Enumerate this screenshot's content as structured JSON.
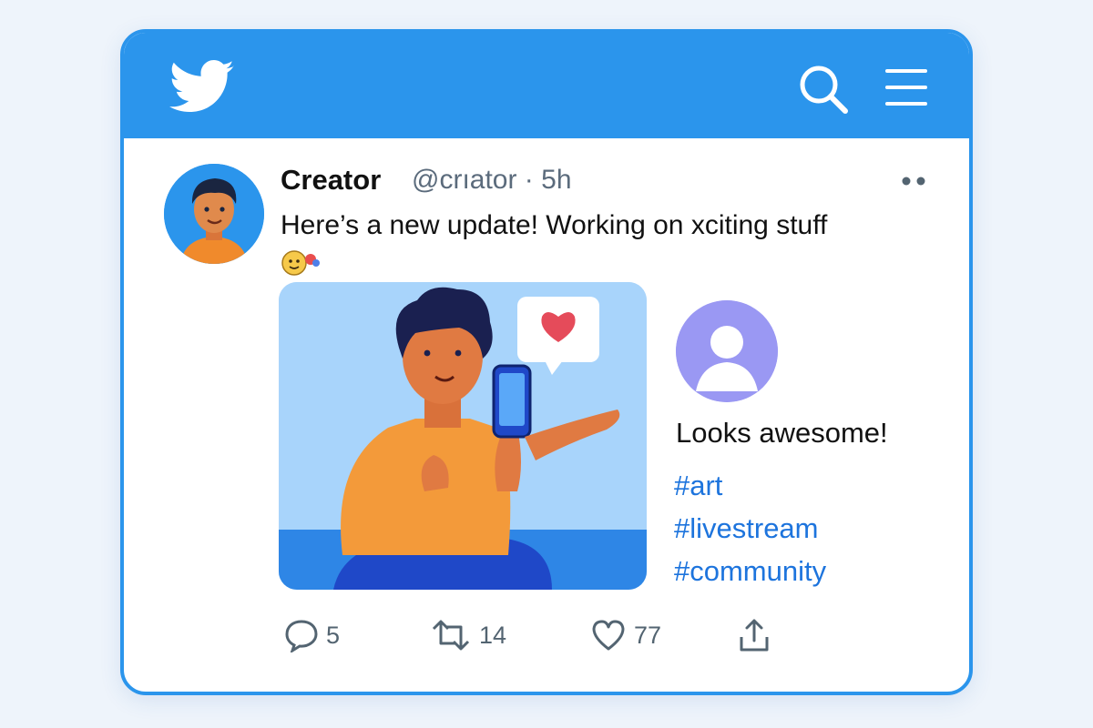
{
  "header": {
    "logo_icon": "bird-icon",
    "search_icon": "search-icon",
    "menu_icon": "hamburger-menu-icon",
    "color": "#2b95ec"
  },
  "tweet": {
    "author_name": "Creator",
    "author_handle": "@crıator · 5h",
    "text": "Here’s a new update! Working on xciting stuff",
    "more_icon": "more-options-icon",
    "emoji_icon": "emoji-icon"
  },
  "reply": {
    "avatar_icon": "user-avatar-icon",
    "text": "Looks awesome!",
    "hashtags": [
      "#art",
      "#livestream",
      "#community"
    ],
    "hashtag_color": "#1d74dd"
  },
  "actions": {
    "reply_count": "5",
    "retweet_count": "14",
    "like_count": "77",
    "share_icon": "share-icon"
  }
}
